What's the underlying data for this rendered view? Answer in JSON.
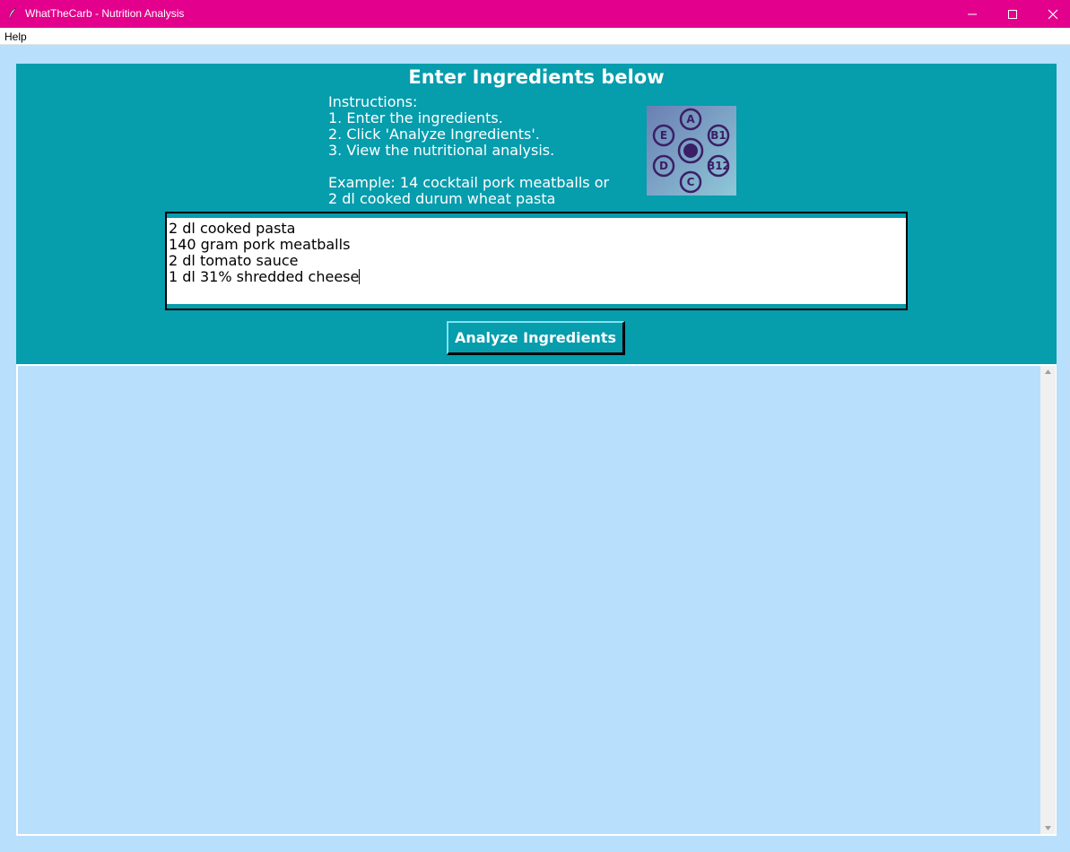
{
  "window": {
    "title": "WhatTheCarb - Nutrition Analysis",
    "controls": {
      "minimize": "minimize-icon",
      "maximize": "maximize-icon",
      "close": "close-icon"
    }
  },
  "menu": {
    "items": [
      "Help"
    ]
  },
  "panel": {
    "heading": "Enter Ingredients below",
    "instructions": [
      "Instructions:",
      "1. Enter the ingredients.",
      "2. Click 'Analyze Ingredients'.",
      "3. View the nutritional analysis.",
      "",
      "Example: 14 cocktail pork meatballs or",
      "2 dl cooked durum wheat pasta"
    ],
    "logo": {
      "icon": "vitamins-logo-icon",
      "letters": [
        "A",
        "B1",
        "B12",
        "C",
        "D",
        "E"
      ]
    }
  },
  "ingredients_input": {
    "lines": [
      "2 dl cooked pasta",
      "140 gram pork meatballs",
      "2 dl tomato sauce",
      "1 dl 31% shredded cheese"
    ]
  },
  "analyze_button": {
    "label": "Analyze Ingredients"
  },
  "results": {
    "content": ""
  },
  "colors": {
    "titlebar": "#e3008c",
    "panel": "#069dad",
    "background": "#b8dffb",
    "input_bg": "#ffffff"
  }
}
